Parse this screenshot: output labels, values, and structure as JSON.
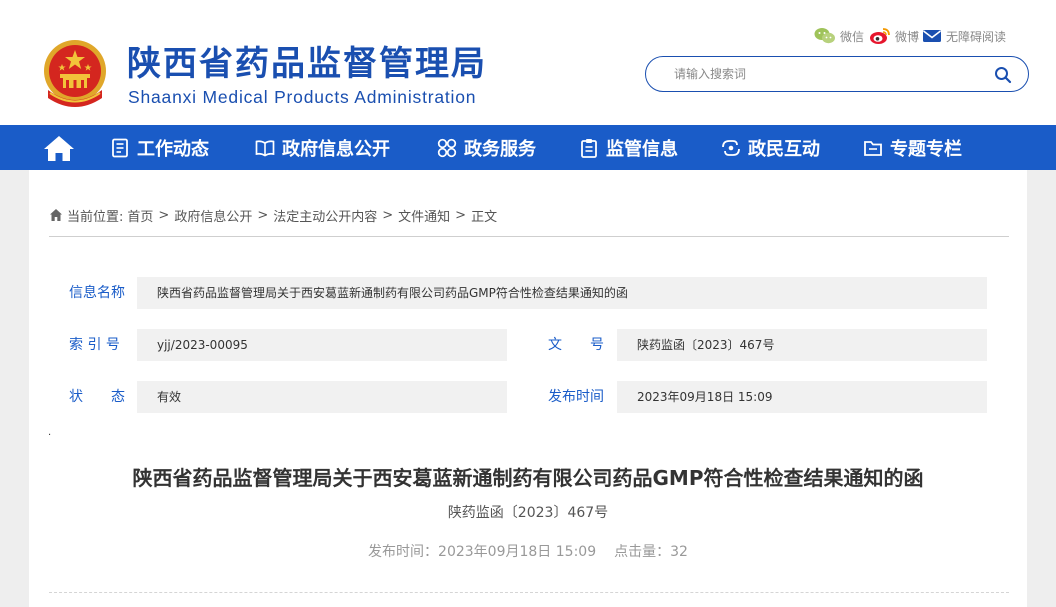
{
  "header": {
    "site_title": "陕西省药品监督管理局",
    "site_subtitle": "Shaanxi Medical Products Administration",
    "social": {
      "wechat": "微信",
      "weibo": "微博",
      "accessibility": "无障碍阅读"
    },
    "search": {
      "placeholder": "请输入搜索词"
    }
  },
  "nav": {
    "items": [
      {
        "label": "工作动态",
        "icon": "document-list-icon"
      },
      {
        "label": "政府信息公开",
        "icon": "open-book-icon"
      },
      {
        "label": "政务服务",
        "icon": "grid-circles-icon"
      },
      {
        "label": "监管信息",
        "icon": "clipboard-icon"
      },
      {
        "label": "政民互动",
        "icon": "interaction-icon"
      },
      {
        "label": "专题专栏",
        "icon": "folder-icon"
      }
    ]
  },
  "breadcrumb": {
    "prefix": "当前位置:",
    "items": [
      "首页",
      "政府信息公开",
      "法定主动公开内容",
      "文件通知",
      "正文"
    ],
    "separator": ">"
  },
  "info": {
    "name_label": "信息名称",
    "name_value": "陕西省药品监督管理局关于西安葛蓝新通制药有限公司药品GMP符合性检查结果通知的函",
    "index_label": "索 引 号",
    "index_value": "yjj/2023-00095",
    "docno_label": "文　　号",
    "docno_value": "陕药监函〔2023〕467号",
    "status_label": "状　　态",
    "status_value": "有效",
    "pubtime_label": "发布时间",
    "pubtime_value": "2023年09月18日 15:09"
  },
  "article": {
    "dot": ".",
    "title": "陕西省药品监督管理局关于西安葛蓝新通制药有限公司药品GMP符合性检查结果通知的函",
    "doc_number": "陕药监函〔2023〕467号",
    "publish_text": "发布时间：2023年09月18日 15:09",
    "views_text": "点击量：32"
  },
  "colors": {
    "brand_blue": "#1a4fb0",
    "nav_blue": "#1a5cc8",
    "emblem_red": "#d4261f",
    "emblem_gold": "#f2c43a"
  }
}
